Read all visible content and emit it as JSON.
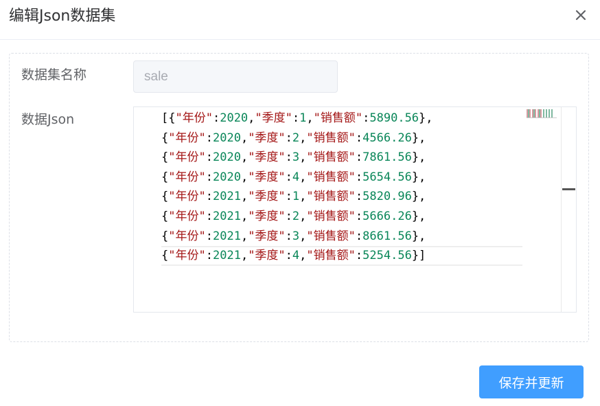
{
  "dialog": {
    "title": "编辑Json数据集",
    "close_icon": "close-icon"
  },
  "form": {
    "name_label": "数据集名称",
    "name_value": "sale",
    "json_label": "数据Json"
  },
  "editor": {
    "lines": [
      [
        [
          "[{",
          "p"
        ],
        [
          "\"年份\"",
          "s"
        ],
        [
          ":",
          "p"
        ],
        [
          "2020",
          "n"
        ],
        [
          ",",
          "p"
        ],
        [
          "\"季度\"",
          "s"
        ],
        [
          ":",
          "p"
        ],
        [
          "1",
          "n"
        ],
        [
          ",",
          "p"
        ],
        [
          "\"销售额\"",
          "s"
        ],
        [
          ":",
          "p"
        ],
        [
          "5890.56",
          "n"
        ],
        [
          "},",
          "p"
        ]
      ],
      [
        [
          "{",
          "p"
        ],
        [
          "\"年份\"",
          "s"
        ],
        [
          ":",
          "p"
        ],
        [
          "2020",
          "n"
        ],
        [
          ",",
          "p"
        ],
        [
          "\"季度\"",
          "s"
        ],
        [
          ":",
          "p"
        ],
        [
          "2",
          "n"
        ],
        [
          ",",
          "p"
        ],
        [
          "\"销售额\"",
          "s"
        ],
        [
          ":",
          "p"
        ],
        [
          "4566.26",
          "n"
        ],
        [
          "},",
          "p"
        ]
      ],
      [
        [
          "{",
          "p"
        ],
        [
          "\"年份\"",
          "s"
        ],
        [
          ":",
          "p"
        ],
        [
          "2020",
          "n"
        ],
        [
          ",",
          "p"
        ],
        [
          "\"季度\"",
          "s"
        ],
        [
          ":",
          "p"
        ],
        [
          "3",
          "n"
        ],
        [
          ",",
          "p"
        ],
        [
          "\"销售额\"",
          "s"
        ],
        [
          ":",
          "p"
        ],
        [
          "7861.56",
          "n"
        ],
        [
          "},",
          "p"
        ]
      ],
      [
        [
          "{",
          "p"
        ],
        [
          "\"年份\"",
          "s"
        ],
        [
          ":",
          "p"
        ],
        [
          "2020",
          "n"
        ],
        [
          ",",
          "p"
        ],
        [
          "\"季度\"",
          "s"
        ],
        [
          ":",
          "p"
        ],
        [
          "4",
          "n"
        ],
        [
          ",",
          "p"
        ],
        [
          "\"销售额\"",
          "s"
        ],
        [
          ":",
          "p"
        ],
        [
          "5654.56",
          "n"
        ],
        [
          "},",
          "p"
        ]
      ],
      [
        [
          "{",
          "p"
        ],
        [
          "\"年份\"",
          "s"
        ],
        [
          ":",
          "p"
        ],
        [
          "2021",
          "n"
        ],
        [
          ",",
          "p"
        ],
        [
          "\"季度\"",
          "s"
        ],
        [
          ":",
          "p"
        ],
        [
          "1",
          "n"
        ],
        [
          ",",
          "p"
        ],
        [
          "\"销售额\"",
          "s"
        ],
        [
          ":",
          "p"
        ],
        [
          "5820.96",
          "n"
        ],
        [
          "},",
          "p"
        ]
      ],
      [
        [
          "{",
          "p"
        ],
        [
          "\"年份\"",
          "s"
        ],
        [
          ":",
          "p"
        ],
        [
          "2021",
          "n"
        ],
        [
          ",",
          "p"
        ],
        [
          "\"季度\"",
          "s"
        ],
        [
          ":",
          "p"
        ],
        [
          "2",
          "n"
        ],
        [
          ",",
          "p"
        ],
        [
          "\"销售额\"",
          "s"
        ],
        [
          ":",
          "p"
        ],
        [
          "5666.26",
          "n"
        ],
        [
          "},",
          "p"
        ]
      ],
      [
        [
          "{",
          "p"
        ],
        [
          "\"年份\"",
          "s"
        ],
        [
          ":",
          "p"
        ],
        [
          "2021",
          "n"
        ],
        [
          ",",
          "p"
        ],
        [
          "\"季度\"",
          "s"
        ],
        [
          ":",
          "p"
        ],
        [
          "3",
          "n"
        ],
        [
          ",",
          "p"
        ],
        [
          "\"销售额\"",
          "s"
        ],
        [
          ":",
          "p"
        ],
        [
          "8661.56",
          "n"
        ],
        [
          "},",
          "p"
        ]
      ],
      [
        [
          "{",
          "p"
        ],
        [
          "\"年份\"",
          "s"
        ],
        [
          ":",
          "p"
        ],
        [
          "2021",
          "n"
        ],
        [
          ",",
          "p"
        ],
        [
          "\"季度\"",
          "s"
        ],
        [
          ":",
          "p"
        ],
        [
          "4",
          "n"
        ],
        [
          ",",
          "p"
        ],
        [
          "\"销售额\"",
          "s"
        ],
        [
          ":",
          "p"
        ],
        [
          "5254.56",
          "n"
        ],
        [
          "}]",
          "p"
        ]
      ]
    ],
    "active_line": 7,
    "colors": {
      "punctuation": "#000000",
      "string": "#a31515",
      "number": "#098658"
    }
  },
  "footer": {
    "save_label": "保存并更新",
    "accent_color": "#409eff"
  }
}
